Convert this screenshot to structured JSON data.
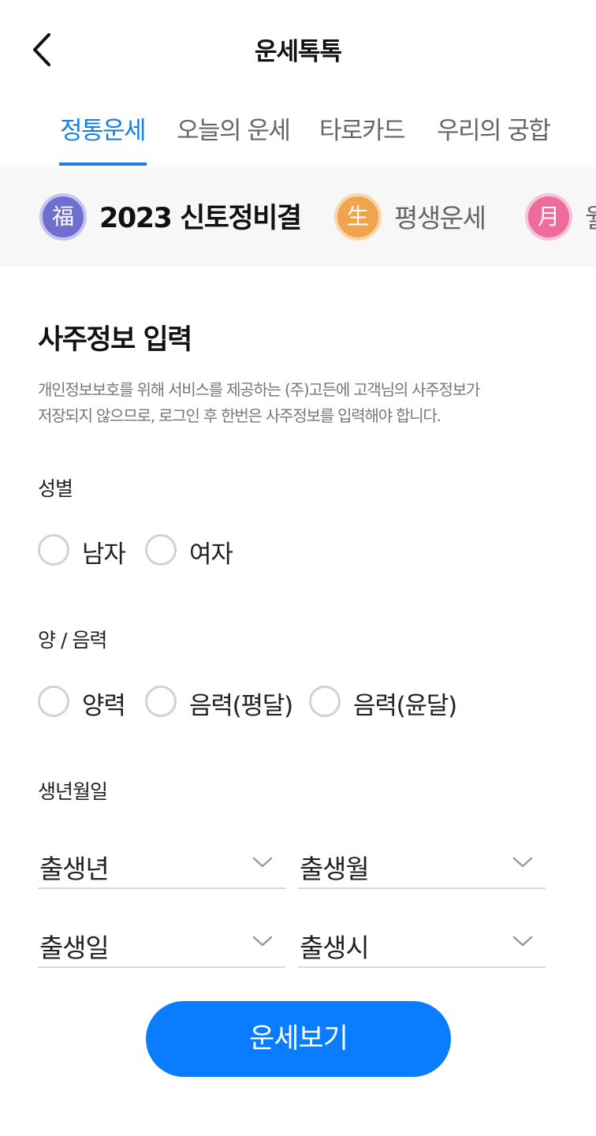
{
  "header": {
    "title": "운세톡톡"
  },
  "tabs": [
    {
      "label": "정통운세",
      "active": true
    },
    {
      "label": "오늘의 운세",
      "active": false
    },
    {
      "label": "타로카드",
      "active": false
    },
    {
      "label": "우리의 궁합",
      "active": false
    }
  ],
  "categories": [
    {
      "badge": "福",
      "label": "2023 신토정비결",
      "color": "#6e6fcf",
      "active": true
    },
    {
      "badge": "生",
      "label": "평생운세",
      "color": "#f0a44e",
      "active": false
    },
    {
      "badge": "月",
      "label": "월",
      "color": "#ee6c9c",
      "active": false
    }
  ],
  "form": {
    "title": "사주정보 입력",
    "description_line1": "개인정보보호를 위해 서비스를 제공하는 (주)고든에 고객님의 사주정보가",
    "description_line2": "저장되지 않으므로, 로그인 후 한번은 사주정보를 입력해야 합니다.",
    "gender": {
      "label": "성별",
      "options": [
        "남자",
        "여자"
      ],
      "selected": null
    },
    "calendar": {
      "label": "양 / 음력",
      "options": [
        "양력",
        "음력(평달)",
        "음력(윤달)"
      ],
      "selected": null
    },
    "birth": {
      "label": "생년월일",
      "year_placeholder": "출생년",
      "month_placeholder": "출생월",
      "day_placeholder": "출생일",
      "hour_placeholder": "출생시"
    }
  },
  "cta": {
    "label": "운세보기"
  },
  "colors": {
    "accent": "#0a7cff",
    "tab_active": "#1a7fe0"
  }
}
